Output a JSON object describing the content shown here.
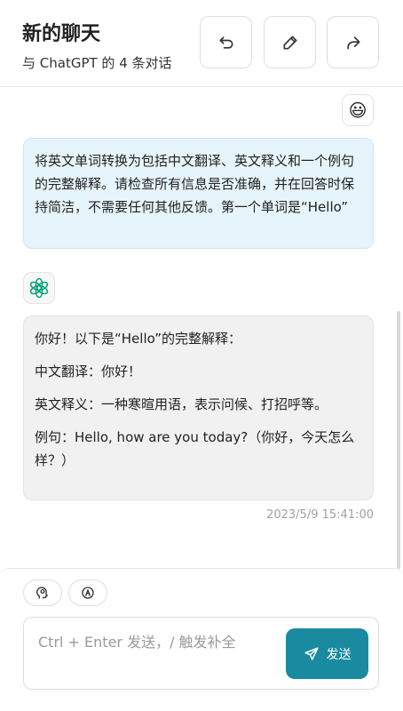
{
  "header": {
    "title": "新的聊天",
    "subtitle": "与 ChatGPT 的 4 条对话",
    "buttons": [
      {
        "icon": "undo-icon"
      },
      {
        "icon": "edit-icon"
      },
      {
        "icon": "share-icon"
      }
    ]
  },
  "messages": [
    {
      "role": "user",
      "avatar": "😃",
      "text": "将英文单词转换为包括中文翻译、英文释义和一个例句的完整解释。请检查所有信息是否准确，并在回答时保持简洁，不需要任何其他反馈。第一个单词是“Hello”"
    },
    {
      "role": "assistant",
      "avatar_icon": "openai-logo-icon",
      "paragraphs": [
        "你好！以下是“Hello”的完整解释：",
        "中文翻译：你好！",
        "英文释义：一种寒暄用语，表示问候、打招呼等。",
        "例句：Hello, how are you today?（你好，今天怎么样？）"
      ],
      "timestamp": "2023/5/9 15:41:00"
    }
  ],
  "toolbar": {
    "chips": [
      {
        "icon": "prompt-brain-icon"
      },
      {
        "icon": "mask-icon"
      }
    ]
  },
  "composer": {
    "placeholder": "Ctrl + Enter 发送，/ 触发补全",
    "value": "",
    "send_label": "发送",
    "send_color": "#1a8aa0"
  }
}
